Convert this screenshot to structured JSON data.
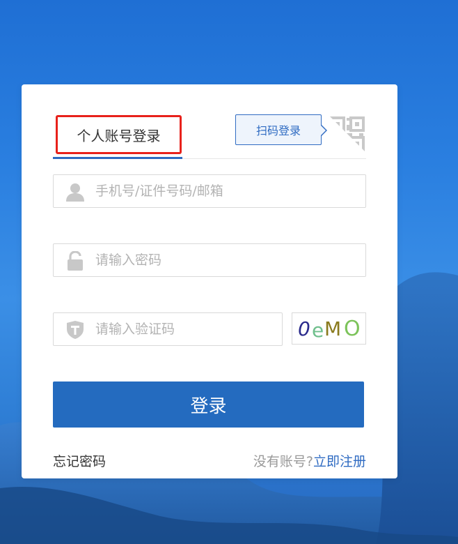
{
  "tabs": {
    "personal_login": "个人账号登录"
  },
  "qr": {
    "tip_label": "扫码登录"
  },
  "fields": {
    "account_placeholder": "手机号/证件号码/邮箱",
    "password_placeholder": "请输入密码",
    "captcha_placeholder": "请输入验证码",
    "captcha_text": "0eMO"
  },
  "actions": {
    "login_label": "登录",
    "forgot_label": "忘记密码",
    "no_account_label": "没有账号?",
    "register_label": "立即注册"
  },
  "colors": {
    "primary": "#246bbf",
    "link": "#2f6bc2",
    "highlight_box": "#e8211b"
  },
  "icons": {
    "account": "user-icon",
    "password": "lock-icon",
    "captcha": "shield-icon",
    "qr": "qr-code-icon"
  }
}
